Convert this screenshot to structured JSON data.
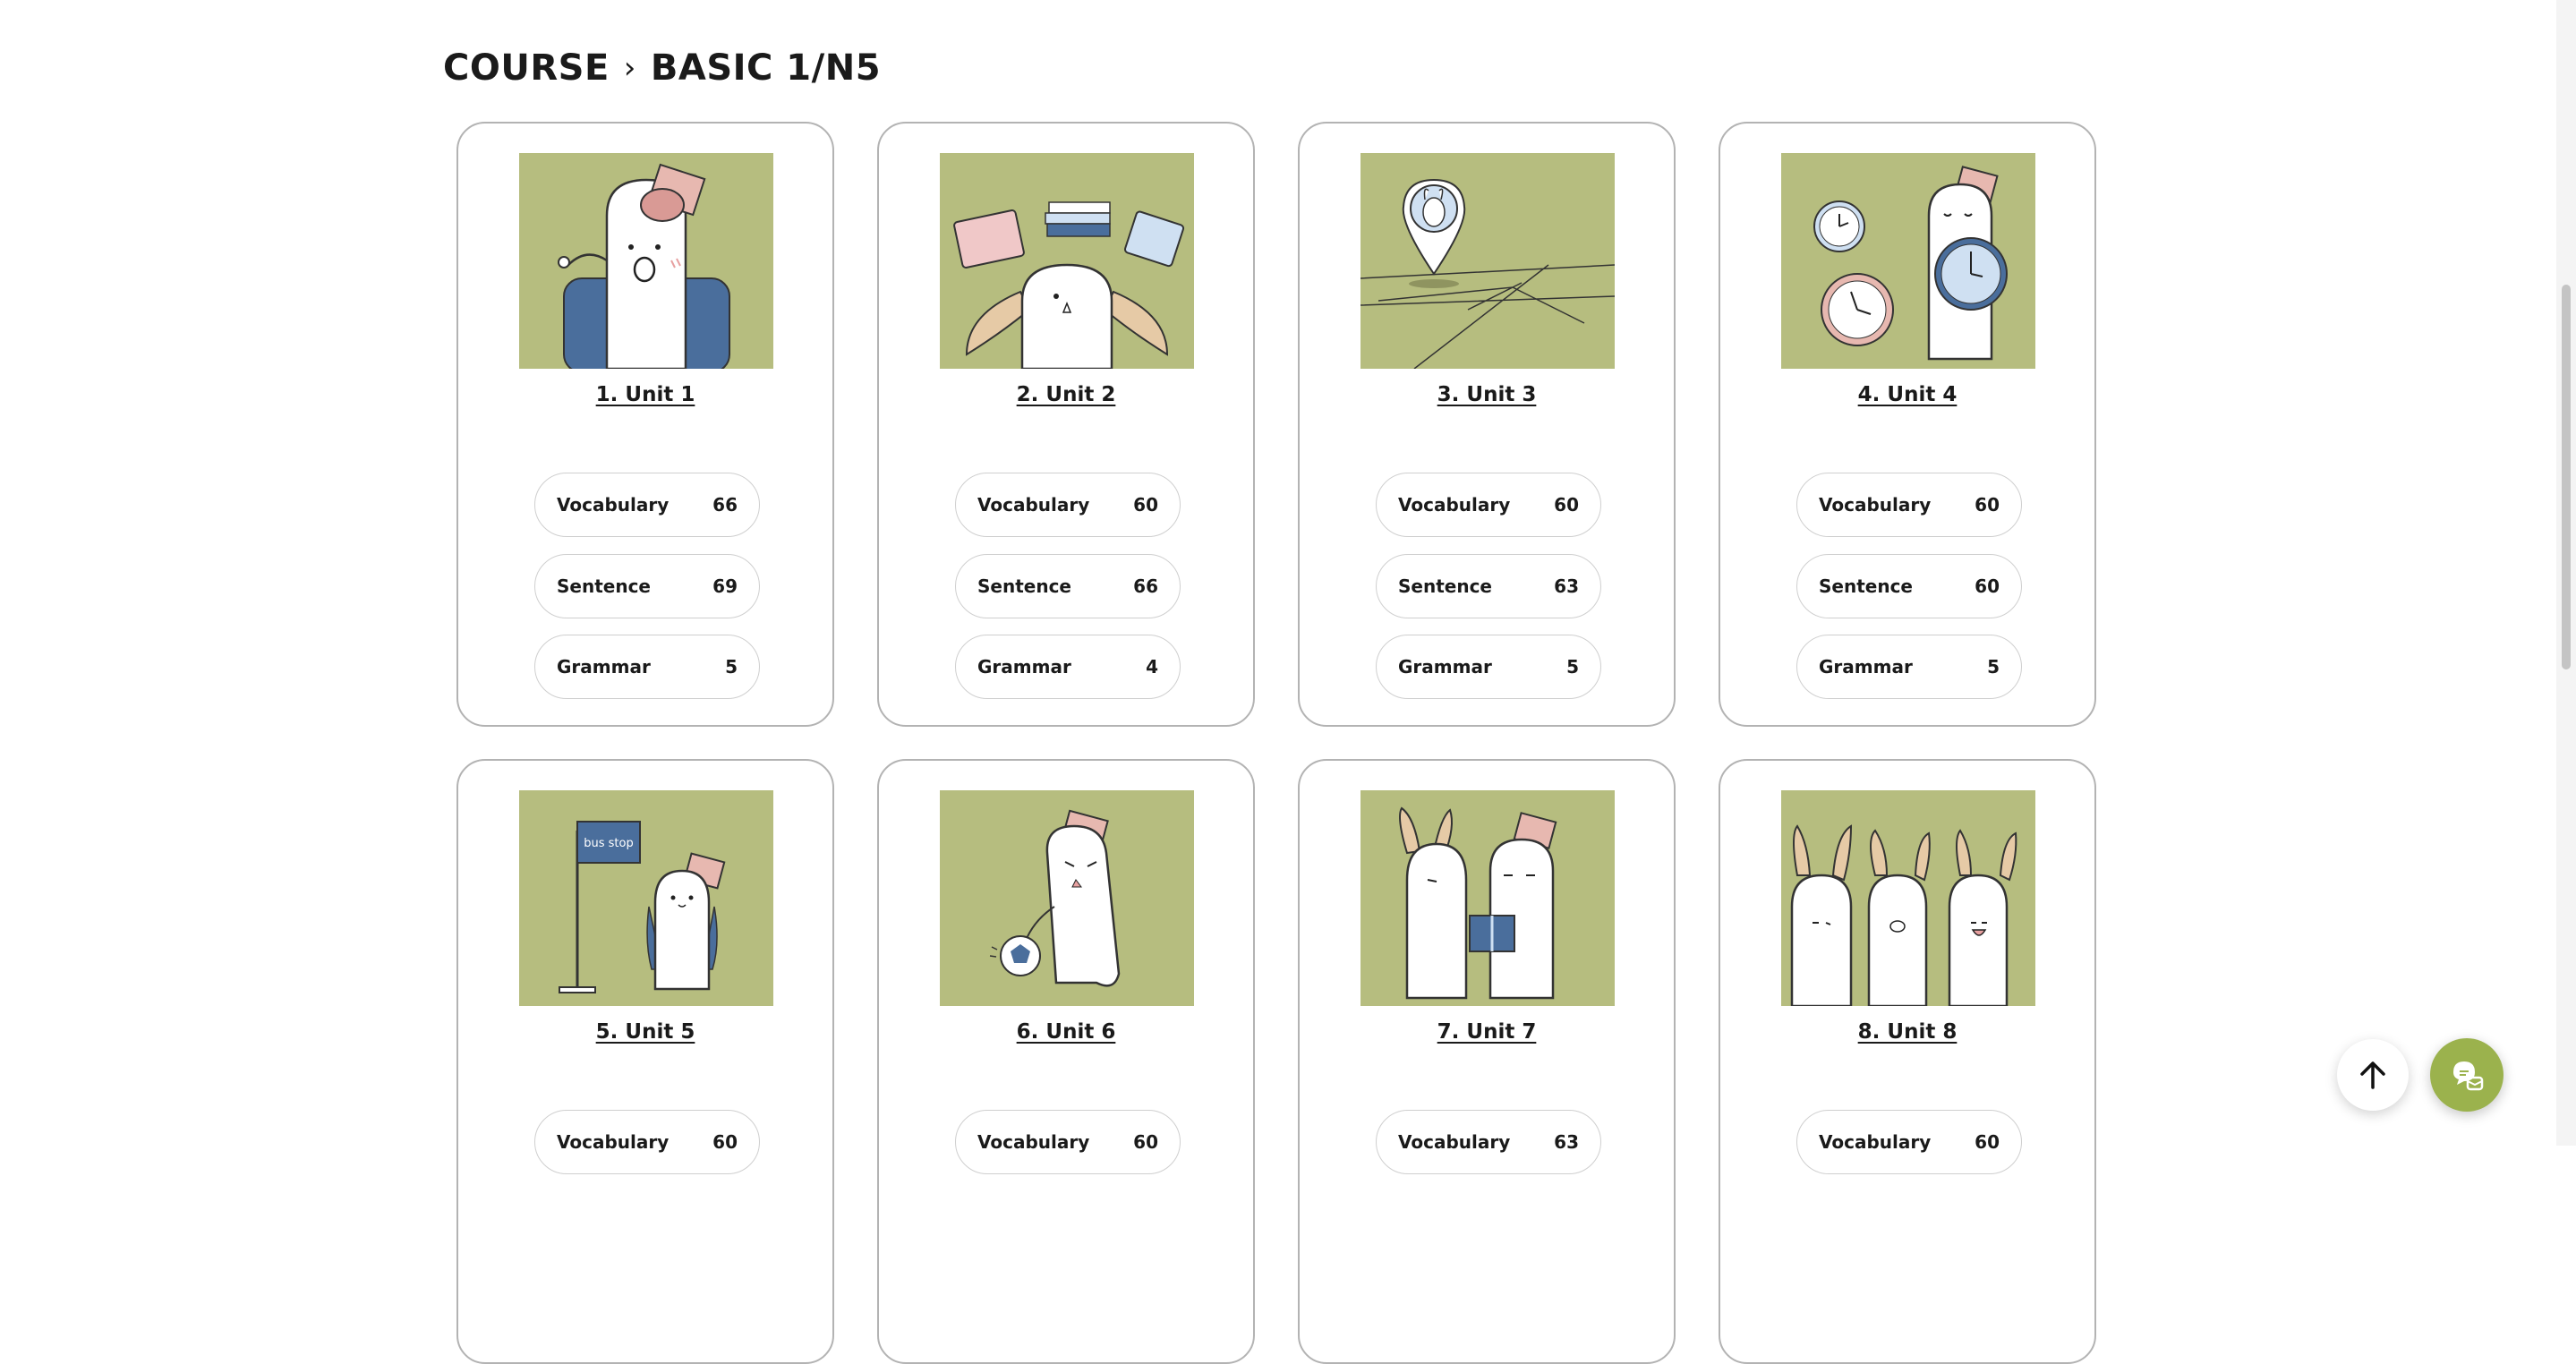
{
  "breadcrumb": {
    "root": "COURSE",
    "separator": "›",
    "current": "BASIC 1/N5"
  },
  "units": [
    {
      "title": "1. Unit 1",
      "stats": [
        {
          "label": "Vocabulary",
          "count": "66"
        },
        {
          "label": "Sentence",
          "count": "69"
        },
        {
          "label": "Grammar",
          "count": "5"
        }
      ]
    },
    {
      "title": "2. Unit 2",
      "stats": [
        {
          "label": "Vocabulary",
          "count": "60"
        },
        {
          "label": "Sentence",
          "count": "66"
        },
        {
          "label": "Grammar",
          "count": "4"
        }
      ]
    },
    {
      "title": "3. Unit 3",
      "stats": [
        {
          "label": "Vocabulary",
          "count": "60"
        },
        {
          "label": "Sentence",
          "count": "63"
        },
        {
          "label": "Grammar",
          "count": "5"
        }
      ]
    },
    {
      "title": "4. Unit 4",
      "stats": [
        {
          "label": "Vocabulary",
          "count": "60"
        },
        {
          "label": "Sentence",
          "count": "60"
        },
        {
          "label": "Grammar",
          "count": "5"
        }
      ]
    },
    {
      "title": "5. Unit 5",
      "stats": [
        {
          "label": "Vocabulary",
          "count": "60"
        }
      ]
    },
    {
      "title": "6. Unit 6",
      "stats": [
        {
          "label": "Vocabulary",
          "count": "60"
        }
      ]
    },
    {
      "title": "7. Unit 7",
      "stats": [
        {
          "label": "Vocabulary",
          "count": "63"
        }
      ]
    },
    {
      "title": "8. Unit 8",
      "stats": [
        {
          "label": "Vocabulary",
          "count": "60"
        }
      ]
    }
  ],
  "illustrations": {
    "unit5_sign": "bus stop"
  },
  "icons": {
    "back_to_top": "arrow-up-icon",
    "chat": "chat-icon"
  },
  "colors": {
    "thumbnail_bg": "#b6bd7f",
    "accent": "#9bb24d",
    "card_border": "#b3b3b3"
  }
}
